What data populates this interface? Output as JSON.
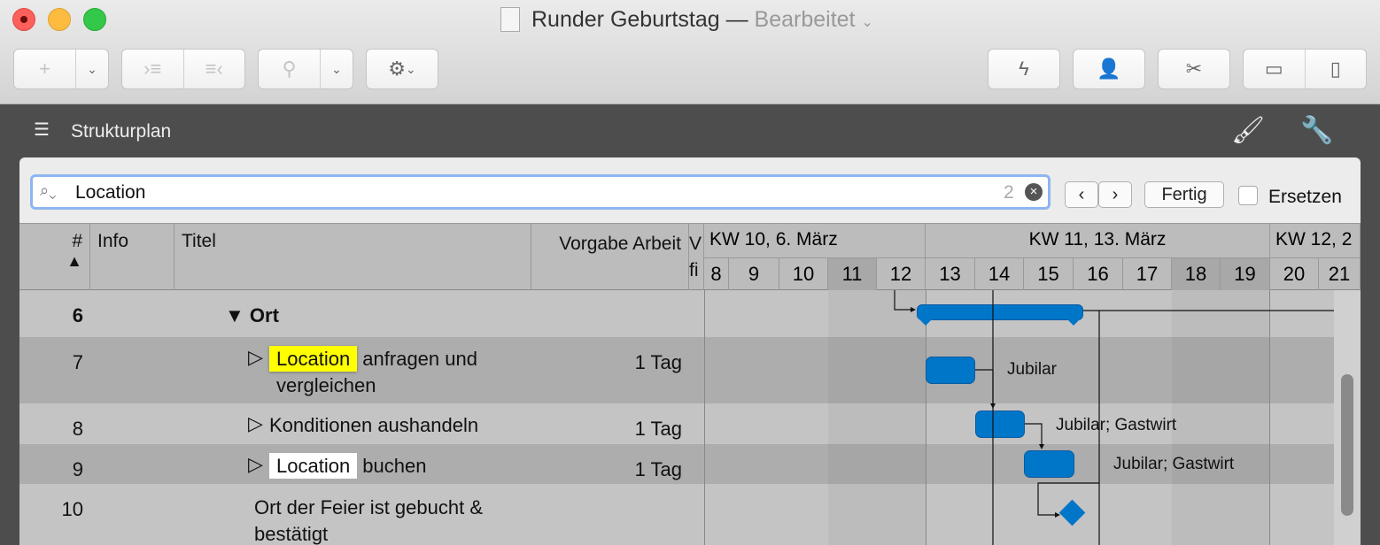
{
  "window": {
    "title": "Runder Geburtstag",
    "separator": "—",
    "status": "Bearbeitet"
  },
  "toolbar": {
    "left": [
      "add",
      "outdent",
      "indent",
      "attach",
      "settings"
    ],
    "right": [
      "lightning",
      "person",
      "tools",
      "bottom-panel",
      "right-panel"
    ]
  },
  "view": {
    "name": "Strukturplan"
  },
  "search": {
    "value": "Location",
    "count": "2",
    "done_label": "Fertig",
    "replace_label": "Ersetzen"
  },
  "columns": {
    "num": "#",
    "info": "Info",
    "title": "Titel",
    "work": "Vorgabe Arbeit",
    "cut": "V fi"
  },
  "weeks": [
    "KW 10, 6. März",
    "KW 11, 13. März",
    "KW 12, 2"
  ],
  "days": [
    "8",
    "9",
    "10",
    "11",
    "12",
    "13",
    "14",
    "15",
    "16",
    "17",
    "18",
    "19",
    "20",
    "21"
  ],
  "rows": [
    {
      "num": "6",
      "title": "Ort",
      "work": ""
    },
    {
      "num": "7",
      "title_match": "Location",
      "title": " anfragen und",
      "title2": "vergleichen",
      "work": "1 Tag",
      "resource": "Jubilar"
    },
    {
      "num": "8",
      "title": "Konditionen aushandeln",
      "work": "1 Tag",
      "resource": "Jubilar; Gastwirt"
    },
    {
      "num": "9",
      "title_match": "Location",
      "title": " buchen",
      "work": "1 Tag",
      "resource": "Jubilar; Gastwirt"
    },
    {
      "num": "10",
      "title": "Ort der Feier ist gebucht &",
      "title2": "bestätigt",
      "work": ""
    }
  ],
  "colors": {
    "bar": "#0076c8",
    "highlight": "#ffff00"
  }
}
